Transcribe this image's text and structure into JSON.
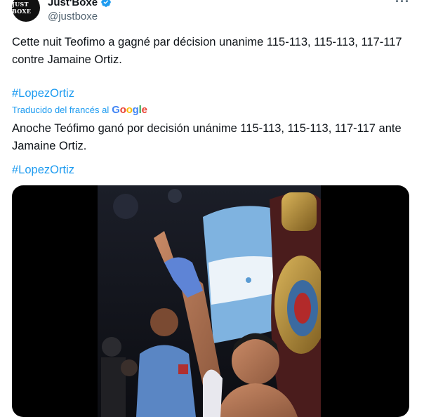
{
  "author": {
    "display_name": "Just'Boxe",
    "handle": "@justboxe",
    "avatar_text": "JUST BOXE",
    "verified_icon": "verified-badge-icon"
  },
  "more_icon": "more-options-icon",
  "tweet": {
    "text_lines": [
      "Cette nuit Teofimo a gagné par décision unanime 115-113, 115-113, 117-117",
      "contre Jamaine Ortiz."
    ],
    "hashtag": "#LopezOrtiz"
  },
  "translation": {
    "label": "Traducido del francés al",
    "provider": "Google",
    "text_lines": [
      "Anoche Teófimo ganó por decisión unánime 115-113, 115-113, 117-117 ante",
      "Jamaine Ortiz."
    ],
    "hashtag": "#LopezOrtiz"
  },
  "media": {
    "type": "video-frame",
    "description_icon": "boxer-celebrating-image"
  },
  "colors": {
    "link": "#1d9bf0",
    "text": "#0f1419",
    "secondary": "#536471",
    "verified": "#1d9bf0"
  }
}
